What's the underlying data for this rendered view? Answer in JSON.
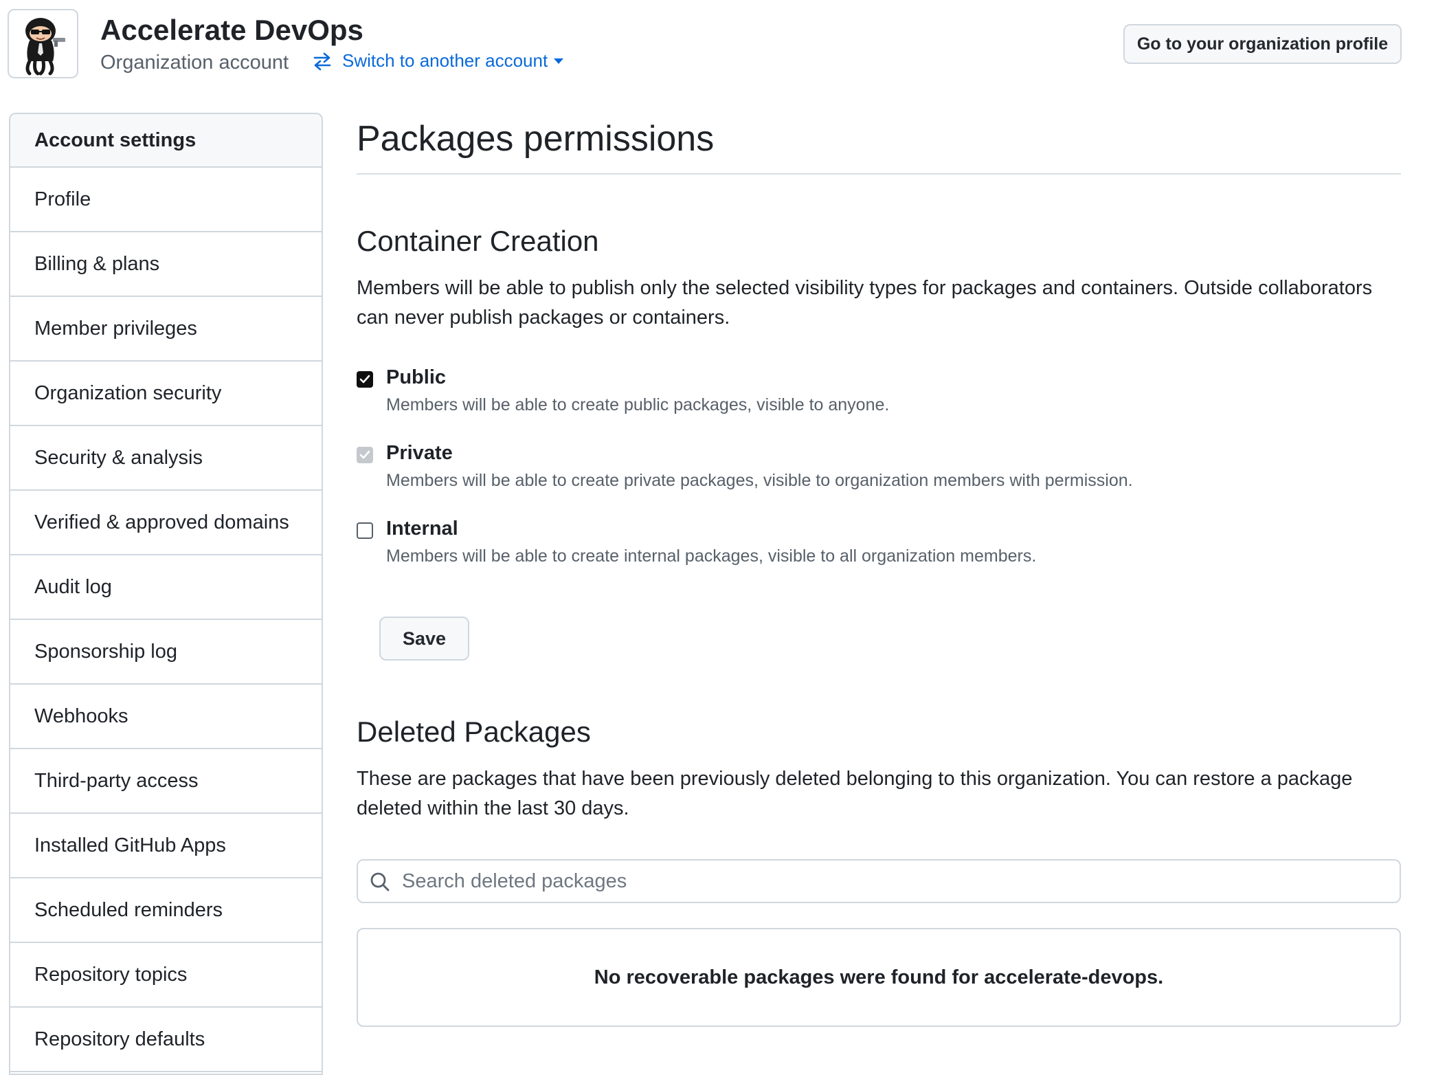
{
  "header": {
    "org_name": "Accelerate DevOps",
    "org_type": "Organization account",
    "switch_label": "Switch to another account",
    "profile_button": "Go to your organization profile"
  },
  "sidebar": {
    "heading": "Account settings",
    "items": [
      {
        "label": "Profile"
      },
      {
        "label": "Billing & plans"
      },
      {
        "label": "Member privileges"
      },
      {
        "label": "Organization security"
      },
      {
        "label": "Security & analysis"
      },
      {
        "label": "Verified & approved domains"
      },
      {
        "label": "Audit log"
      },
      {
        "label": "Sponsorship log"
      },
      {
        "label": "Webhooks"
      },
      {
        "label": "Third-party access"
      },
      {
        "label": "Installed GitHub Apps"
      },
      {
        "label": "Scheduled reminders"
      },
      {
        "label": "Repository topics"
      },
      {
        "label": "Repository defaults"
      }
    ]
  },
  "main": {
    "title": "Packages permissions",
    "container": {
      "title": "Container Creation",
      "description": "Members will be able to publish only the selected visibility types for packages and containers. Outside collaborators can never publish packages or containers.",
      "options": [
        {
          "label": "Public",
          "description": "Members will be able to create public packages, visible to anyone.",
          "state": "checked"
        },
        {
          "label": "Private",
          "description": "Members will be able to create private packages, visible to organization members with permission.",
          "state": "checked-disabled"
        },
        {
          "label": "Internal",
          "description": "Members will be able to create internal packages, visible to all organization members.",
          "state": "unchecked"
        }
      ],
      "save_label": "Save"
    },
    "deleted": {
      "title": "Deleted Packages",
      "description": "These are packages that have been previously deleted belonging to this organization. You can restore a package deleted within the last 30 days.",
      "search_placeholder": "Search deleted packages",
      "empty_message": "No recoverable packages were found for accelerate-devops."
    }
  },
  "colors": {
    "link": "#0969da",
    "border": "#d0d7de",
    "muted_text": "#57606a",
    "checkbox_checked": "#0f0f0f",
    "checkbox_disabled": "#c5c9ce"
  },
  "icons": {
    "avatar": "octocat-avatar",
    "switch": "arrow-switch-icon",
    "dropdown": "triangle-down-icon",
    "search": "search-icon",
    "check": "check-icon"
  }
}
